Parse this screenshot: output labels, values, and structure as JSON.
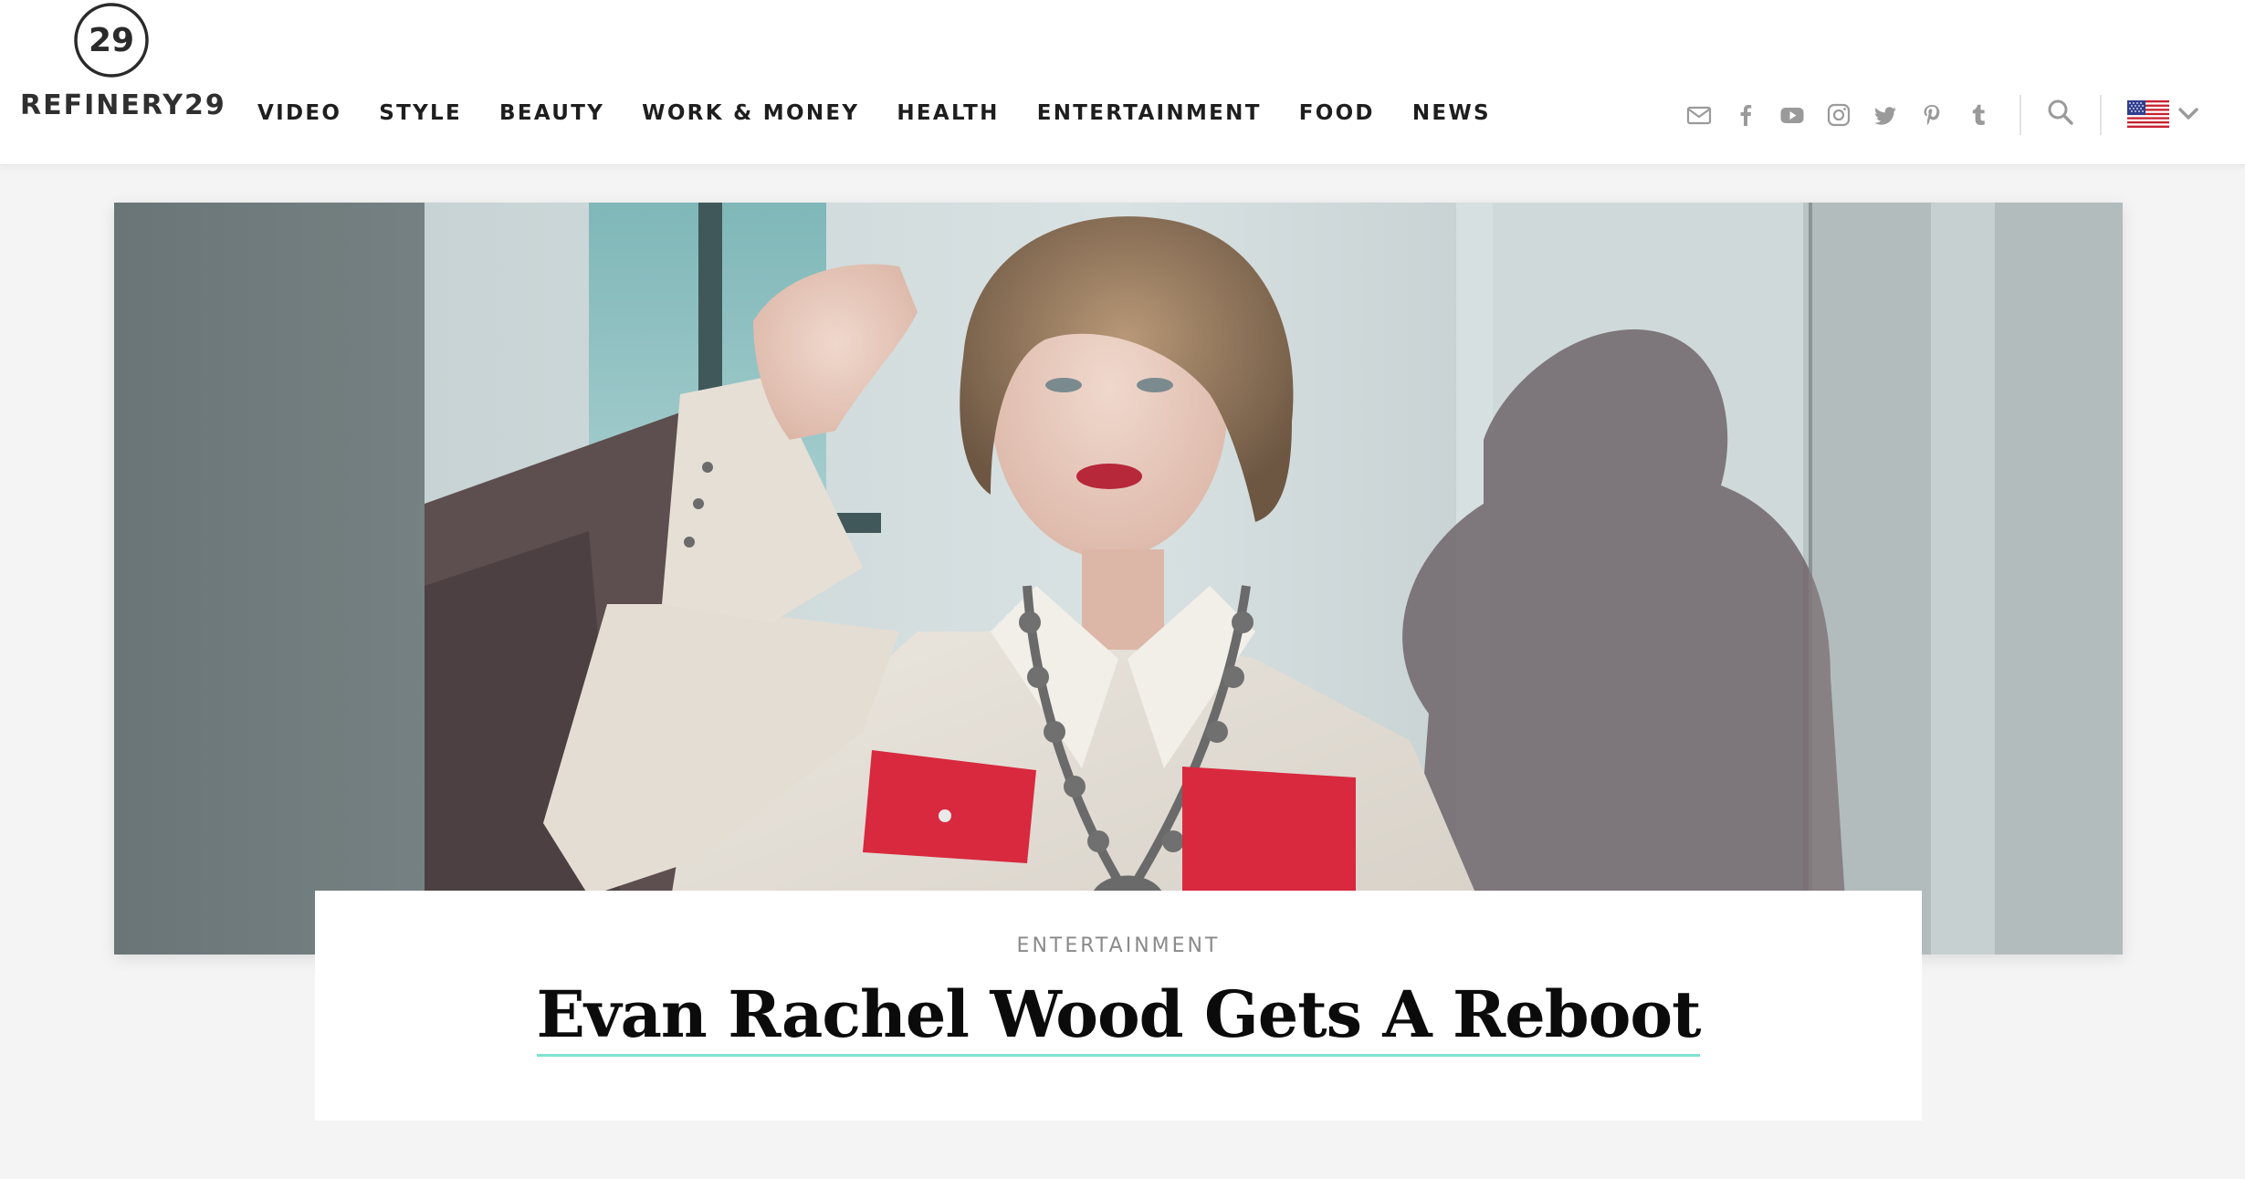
{
  "brand": {
    "logo_mark_text": "29",
    "logo_word": "REFINERY29"
  },
  "nav": {
    "items": [
      {
        "label": "VIDEO"
      },
      {
        "label": "STYLE"
      },
      {
        "label": "BEAUTY"
      },
      {
        "label": "WORK & MONEY"
      },
      {
        "label": "HEALTH"
      },
      {
        "label": "ENTERTAINMENT"
      },
      {
        "label": "FOOD"
      },
      {
        "label": "NEWS"
      }
    ]
  },
  "social": {
    "icons": [
      "email-icon",
      "facebook-icon",
      "youtube-icon",
      "instagram-icon",
      "twitter-icon",
      "pinterest-icon",
      "tumblr-icon"
    ]
  },
  "header_tools": {
    "search_icon": "search-icon",
    "locale_flag": "us-flag-icon",
    "locale_chevron": "chevron-down-icon"
  },
  "article": {
    "category": "ENTERTAINMENT",
    "title": "Evan Rachel Wood Gets A Reboot"
  },
  "colors": {
    "accent_underline": "#7fe3cf",
    "nav_text": "#1e1e1e",
    "icon_gray": "#9a9a9a",
    "page_bg": "#f4f4f4"
  }
}
